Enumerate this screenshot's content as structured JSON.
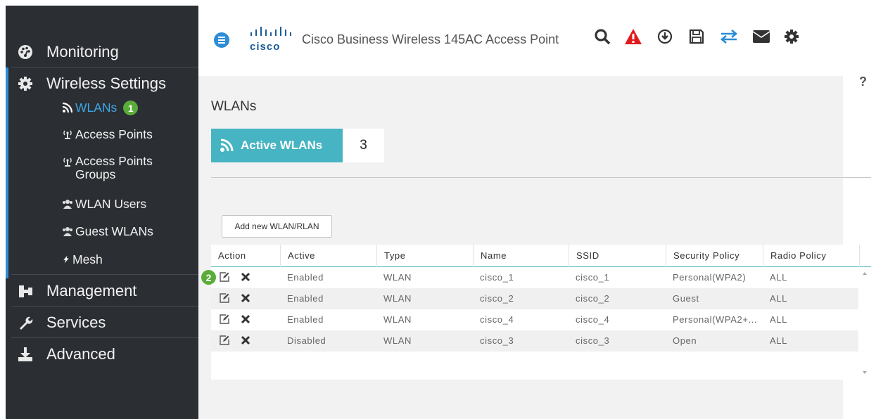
{
  "sidebar": {
    "monitoring": "Monitoring",
    "wireless_settings": "Wireless Settings",
    "wireless_items": [
      {
        "label": "WLANs",
        "active": true,
        "badge": "1"
      },
      {
        "label": "Access Points"
      },
      {
        "label": "Access Points Groups"
      },
      {
        "label": "WLAN Users"
      },
      {
        "label": "Guest WLANs"
      },
      {
        "label": "Mesh"
      }
    ],
    "management": "Management",
    "services": "Services",
    "advanced": "Advanced"
  },
  "header": {
    "logo_text": "cisco",
    "product_name": "Cisco Business Wireless 145AC Access Point",
    "icons": [
      "search-icon",
      "alert-icon",
      "download-icon",
      "save-icon",
      "transfer-icon",
      "mail-icon",
      "gear-icon"
    ]
  },
  "help_label": "?",
  "page": {
    "title": "WLANs",
    "active_tab_label": "Active WLANs",
    "active_count": "3",
    "add_button": "Add new WLAN/RLAN"
  },
  "table": {
    "columns": [
      "Action",
      "Active",
      "Type",
      "Name",
      "SSID",
      "Security Policy",
      "Radio Policy"
    ],
    "rows": [
      {
        "active": "Enabled",
        "type": "WLAN",
        "name": "cisco_1",
        "ssid": "cisco_1",
        "security": "Personal(WPA2)",
        "radio": "ALL"
      },
      {
        "active": "Enabled",
        "type": "WLAN",
        "name": "cisco_2",
        "ssid": "cisco_2",
        "security": "Guest",
        "radio": "ALL"
      },
      {
        "active": "Enabled",
        "type": "WLAN",
        "name": "cisco_4",
        "ssid": "cisco_4",
        "security": "Personal(WPA2+...",
        "radio": "ALL"
      },
      {
        "active": "Disabled",
        "type": "WLAN",
        "name": "cisco_3",
        "ssid": "cisco_3",
        "security": "Open",
        "radio": "ALL"
      }
    ],
    "step_badge": "2"
  },
  "colors": {
    "sidebar_bg": "#2b2e33",
    "accent_blue": "#2d8cd6",
    "tab_teal": "#46b4c2",
    "badge_green": "#5aac3a",
    "alert_red": "#e01b1b"
  }
}
